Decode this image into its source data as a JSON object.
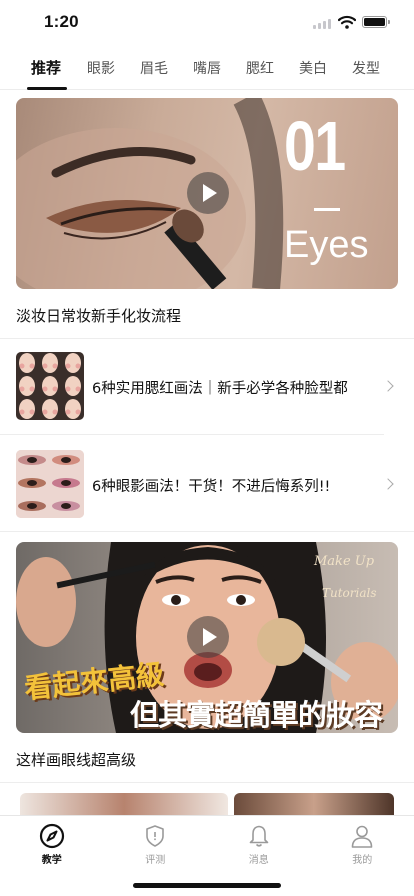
{
  "status_bar": {
    "time": "1:20"
  },
  "tabs": [
    {
      "label": "推荐",
      "active": true
    },
    {
      "label": "眼影"
    },
    {
      "label": "眉毛"
    },
    {
      "label": "嘴唇"
    },
    {
      "label": "腮红"
    },
    {
      "label": "美白"
    },
    {
      "label": "发型"
    }
  ],
  "feed": {
    "video1": {
      "overlay_number": "01",
      "overlay_word": "Eyes",
      "title": "淡妆日常妆新手化妆流程"
    },
    "row1": {
      "title": "6种实用腮红画法｜新手必学各种脸型都"
    },
    "row2": {
      "title": "6种眼影画法！干货！不进后悔系列!!"
    },
    "video2": {
      "script_text_1": "Make Up",
      "script_text_2": "Tutorials",
      "banner_1": "看起來高級",
      "banner_2": "但其實超簡單的妝容",
      "title": "这样画眼线超高级"
    }
  },
  "tabbar": [
    {
      "label": "教学",
      "icon": "compass-icon",
      "active": true
    },
    {
      "label": "评测",
      "icon": "shield-icon"
    },
    {
      "label": "消息",
      "icon": "bell-icon"
    },
    {
      "label": "我的",
      "icon": "person-icon"
    }
  ],
  "colors": {
    "accent": "#111111",
    "inactive": "#9a9a9a",
    "divider": "#ededed"
  }
}
